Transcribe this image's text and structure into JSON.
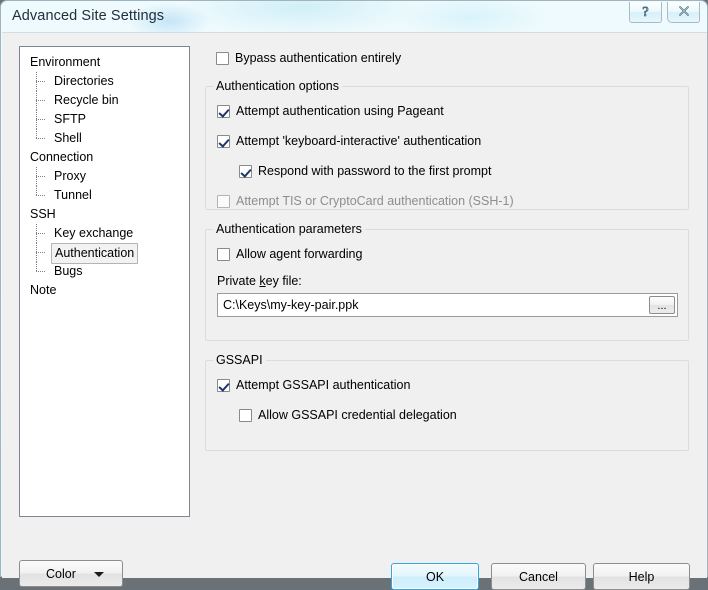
{
  "window": {
    "title": "Advanced Site Settings",
    "caption_buttons": [
      {
        "name": "help-caption-button",
        "glyph": "?"
      },
      {
        "name": "close-caption-button",
        "glyph": "✕"
      }
    ]
  },
  "tree": {
    "nodes": [
      {
        "label": "Environment",
        "level": 0,
        "selected": false,
        "last": false
      },
      {
        "label": "Directories",
        "level": 1,
        "selected": false,
        "last": false
      },
      {
        "label": "Recycle bin",
        "level": 1,
        "selected": false,
        "last": false
      },
      {
        "label": "SFTP",
        "level": 1,
        "selected": false,
        "last": false
      },
      {
        "label": "Shell",
        "level": 1,
        "selected": false,
        "last": true
      },
      {
        "label": "Connection",
        "level": 0,
        "selected": false,
        "last": false
      },
      {
        "label": "Proxy",
        "level": 1,
        "selected": false,
        "last": false
      },
      {
        "label": "Tunnel",
        "level": 1,
        "selected": false,
        "last": true
      },
      {
        "label": "SSH",
        "level": 0,
        "selected": false,
        "last": false
      },
      {
        "label": "Key exchange",
        "level": 1,
        "selected": false,
        "last": false
      },
      {
        "label": "Authentication",
        "level": 1,
        "selected": true,
        "last": false
      },
      {
        "label": "Bugs",
        "level": 1,
        "selected": false,
        "last": true
      },
      {
        "label": "Note",
        "level": 0,
        "selected": false,
        "last": false
      }
    ]
  },
  "content": {
    "bypass": {
      "label": "Bypass authentication entirely",
      "checked": false,
      "disabled": false
    },
    "auth_options": {
      "title": "Authentication options",
      "items": [
        {
          "label": "Attempt authentication using Pageant",
          "checked": true,
          "disabled": false,
          "indent": 0
        },
        {
          "label": "Attempt 'keyboard-interactive' authentication",
          "checked": true,
          "disabled": false,
          "indent": 0
        },
        {
          "label": "Respond with password to the first prompt",
          "checked": true,
          "disabled": false,
          "indent": 1
        },
        {
          "label": "Attempt TIS or CryptoCard authentication (SSH-1)",
          "checked": false,
          "disabled": true,
          "indent": 0
        }
      ]
    },
    "auth_parameters": {
      "title": "Authentication parameters",
      "agent_forwarding": {
        "label": "Allow agent forwarding",
        "checked": false,
        "disabled": false
      },
      "private_key": {
        "label_pre": "Private ",
        "label_accel": "k",
        "label_post": "ey file:",
        "value": "C:\\Keys\\my-key-pair.ppk",
        "browse_label": "..."
      }
    },
    "gssapi": {
      "title": "GSSAPI",
      "items": [
        {
          "label": "Attempt GSSAPI authentication",
          "checked": true,
          "disabled": false,
          "indent": 0
        },
        {
          "label": "Allow GSSAPI credential delegation",
          "checked": false,
          "disabled": false,
          "indent": 1
        }
      ]
    }
  },
  "footer": {
    "color_label": "Color",
    "ok_label": "OK",
    "cancel_label": "Cancel",
    "help_label": "Help"
  },
  "colors": {
    "default_button_border": "#2fa8dd",
    "dialog_background": "#f0f0f0",
    "checkmark": "#21356b",
    "disabled_text": "#8d8d8d"
  }
}
